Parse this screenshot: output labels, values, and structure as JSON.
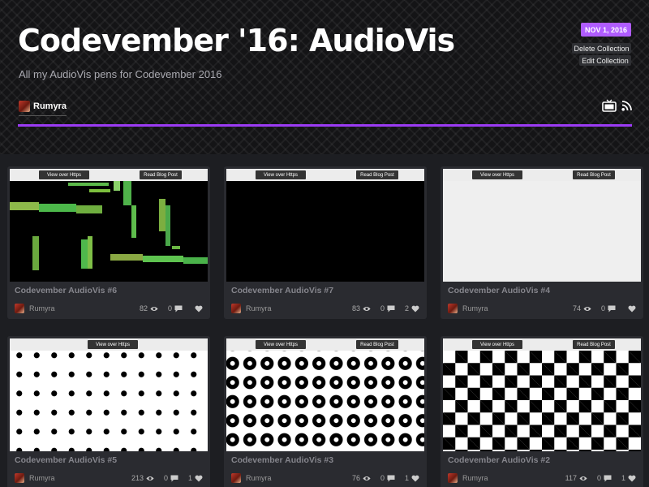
{
  "collection": {
    "title": "Codevember '16: AudioVis",
    "description": "All my AudioVis pens for Codevember 2016",
    "owner": "Rumyra",
    "date": "NOV 1, 2016",
    "delete_label": "Delete Collection",
    "edit_label": "Edit Collection",
    "icons": [
      "tv-icon",
      "rss-icon"
    ],
    "accent_color": "#9b3bf4",
    "badge_color": "#b05cff"
  },
  "preview_buttons": {
    "https": "View over Https",
    "blog": "Read Blog Post"
  },
  "cards": [
    {
      "title": "Codevember AudioVis #6",
      "user": "Rumyra",
      "views": "82",
      "comments": "0",
      "likes": "",
      "pattern": "bars",
      "blog_button": true
    },
    {
      "title": "Codevember AudioVis #7",
      "user": "Rumyra",
      "views": "83",
      "comments": "0",
      "likes": "2",
      "pattern": "black",
      "blog_button": true
    },
    {
      "title": "Codevember AudioVis #4",
      "user": "Rumyra",
      "views": "74",
      "comments": "0",
      "likes": "",
      "pattern": "white",
      "blog_button": true
    },
    {
      "title": "Codevember AudioVis #5",
      "user": "Rumyra",
      "views": "213",
      "comments": "0",
      "likes": "1",
      "pattern": "dots",
      "blog_button": false
    },
    {
      "title": "Codevember AudioVis #3",
      "user": "Rumyra",
      "views": "76",
      "comments": "0",
      "likes": "1",
      "pattern": "rings",
      "blog_button": true
    },
    {
      "title": "Codevember AudioVis #2",
      "user": "Rumyra",
      "views": "117",
      "comments": "0",
      "likes": "1",
      "pattern": "checker",
      "blog_button": true
    }
  ]
}
